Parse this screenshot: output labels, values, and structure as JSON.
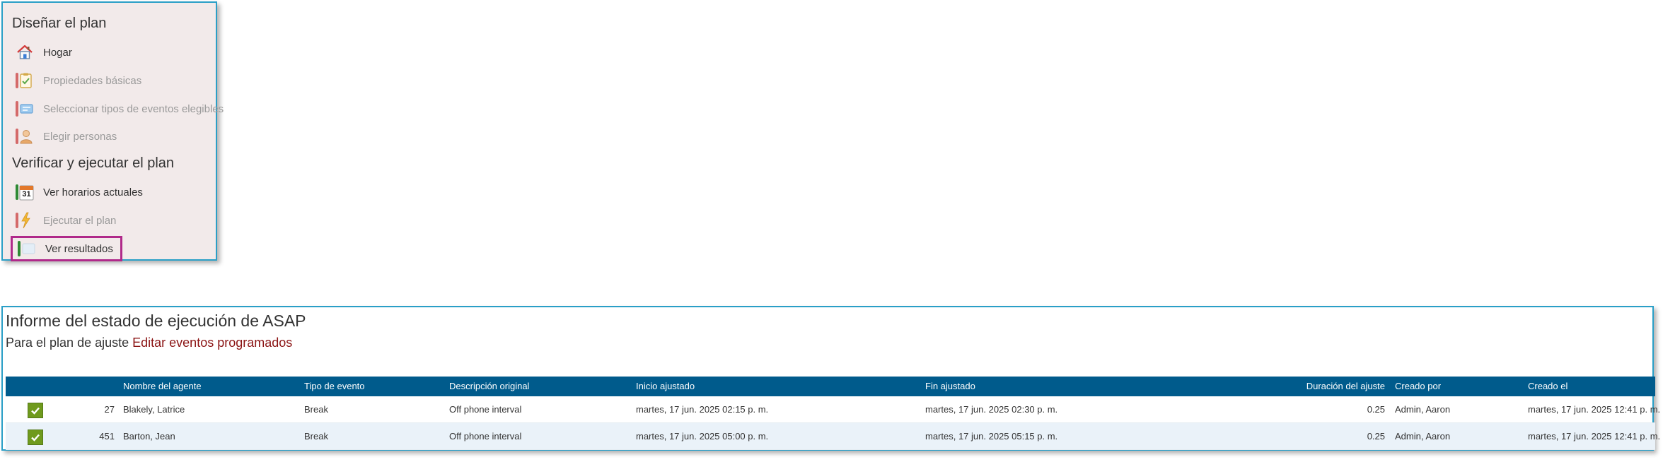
{
  "plan_panel": {
    "design_section": "Diseñar el plan",
    "verify_section": "Verificar y ejecutar el plan",
    "items": [
      {
        "label": "Hogar",
        "icon": "home-icon"
      },
      {
        "label": "Propiedades básicas",
        "icon": "clipboard-check-icon"
      },
      {
        "label": "Seleccionar tipos de eventos elegibles",
        "icon": "event-types-icon"
      },
      {
        "label": "Elegir personas",
        "icon": "person-icon"
      },
      {
        "label": "Ver horarios actuales",
        "icon": "calendar-icon",
        "calendar_day": "31"
      },
      {
        "label": "Ejecutar el plan",
        "icon": "lightning-icon"
      },
      {
        "label": "Ver resultados",
        "icon": "results-icon"
      }
    ]
  },
  "report": {
    "title": "Informe del estado de ejecución de ASAP",
    "subtitle_prefix": "Para el plan de ajuste",
    "subtitle_link": "Editar eventos programados",
    "columns": {
      "agent_name": "Nombre del agente",
      "event_type": "Tipo de evento",
      "original_description": "Descripción original",
      "adjusted_start": "Inicio ajustado",
      "adjusted_end": "Fin ajustado",
      "adjustment_duration": "Duración del ajuste",
      "created_by": "Creado por",
      "created_on": "Creado el"
    },
    "rows": [
      {
        "id": "27",
        "agent_name": "Blakely, Latrice",
        "event_type": "Break",
        "original_description": "Off phone interval",
        "adjusted_start": "martes, 17 jun. 2025 02:15 p. m.",
        "adjusted_end": "martes, 17 jun. 2025 02:30 p. m.",
        "adjustment_duration": "0.25",
        "created_by": "Admin, Aaron",
        "created_on": "martes, 17 jun. 2025 12:41 p. m."
      },
      {
        "id": "451",
        "agent_name": "Barton, Jean",
        "event_type": "Break",
        "original_description": "Off phone interval",
        "adjusted_start": "martes, 17 jun. 2025 05:00 p. m.",
        "adjusted_end": "martes, 17 jun. 2025 05:15 p. m.",
        "adjustment_duration": "0.25",
        "created_by": "Admin, Aaron",
        "created_on": "martes, 17 jun. 2025 12:41 p. m."
      }
    ]
  },
  "colors": {
    "panel_border": "#2a9fc7",
    "panel_bg": "#f2eaea",
    "grid_header": "#005b8c",
    "link": "#8b1414",
    "selected_outline": "#b0298a",
    "check_green": "#6f9a1d"
  }
}
